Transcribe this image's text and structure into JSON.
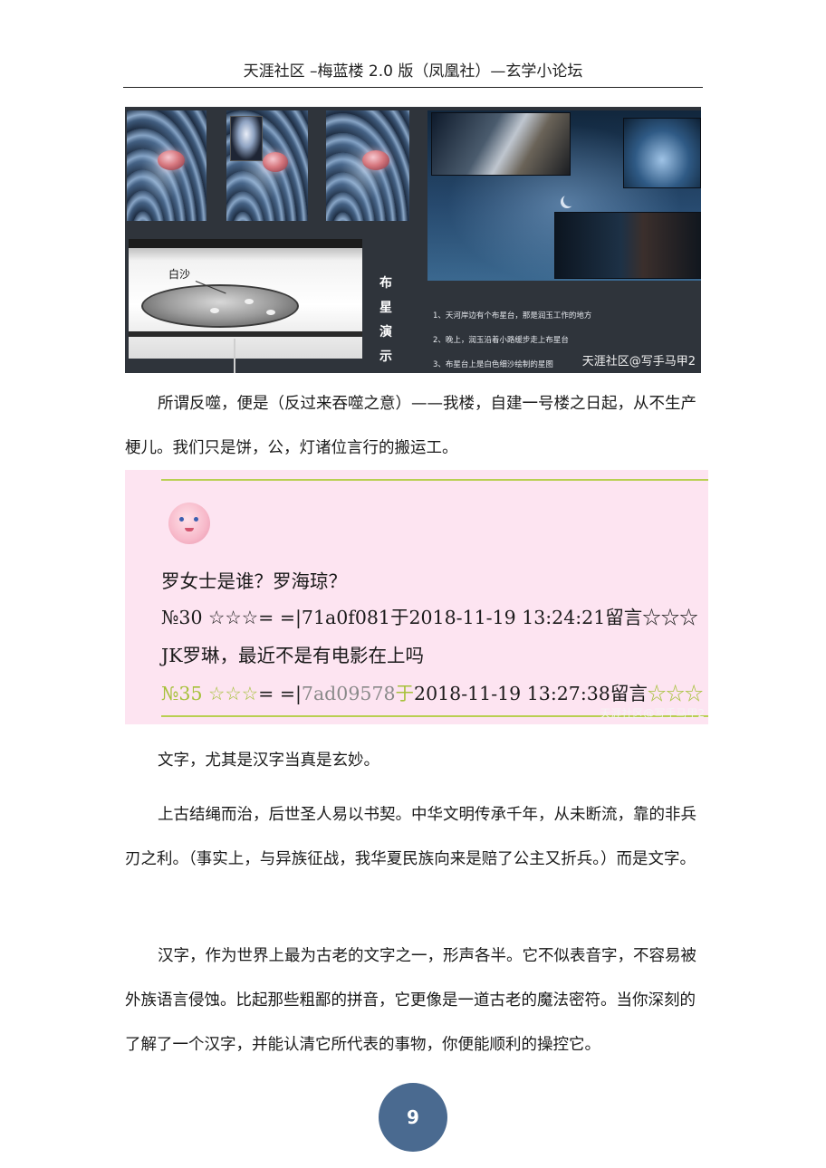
{
  "header": {
    "title": "天涯社区 –梅蓝楼 2.0 版（凤凰社）—玄学小论坛"
  },
  "figure": {
    "bowl_label": "白沙",
    "vertical_title": [
      "布",
      "星",
      "演",
      "示"
    ],
    "steps": [
      "1、天河岸边有个布星台，那是润玉工作的地方",
      "2、晚上，润玉沿着小路缓步走上布星台",
      "3、布星台上是白色细沙绘制的星图"
    ],
    "watermark": "天涯社区@写手马甲2"
  },
  "paragraphs": {
    "p1": "所谓反噬，便是（反过来吞噬之意）——我楼，自建一号楼之日起，从不生产梗儿。我们只是饼，公，灯诸位言行的搬运工。",
    "p2": "文字，尤其是汉字当真是玄妙。",
    "p3": "上古结绳而治，后世圣人易以书契。中华文明传承千年，从未断流，靠的非兵刃之利。（事实上，与异族征战，我华夏民族向来是赔了公主又折兵。）而是文字。",
    "p4": "汉字，作为世界上最为古老的文字之一，形声各半。它不似表音字，不容易被外族语言侵蚀。比起那些粗鄙的拼音，它更像是一道古老的魔法密符。当你深刻的了解了一个汉字，并能认清它所代表的事物，你便能顺利的操控它。"
  },
  "quote": {
    "line1": "罗女士是谁？罗海琼？",
    "line2": "№30 ☆☆☆= =|71a0f081于2018-11-19 13:24:21留言☆☆☆",
    "line3": "JK罗琳，最近不是有电影在上吗",
    "line4_a": "№35 ☆☆☆",
    "line4_b": "= =|",
    "line4_c": "7ad09578",
    "line4_d": "于",
    "line4_e": "2018-11-19 13:27:38留言",
    "line4_f": "☆☆☆",
    "watermark": "天涯社区@写手马甲2"
  },
  "page_number": "9"
}
